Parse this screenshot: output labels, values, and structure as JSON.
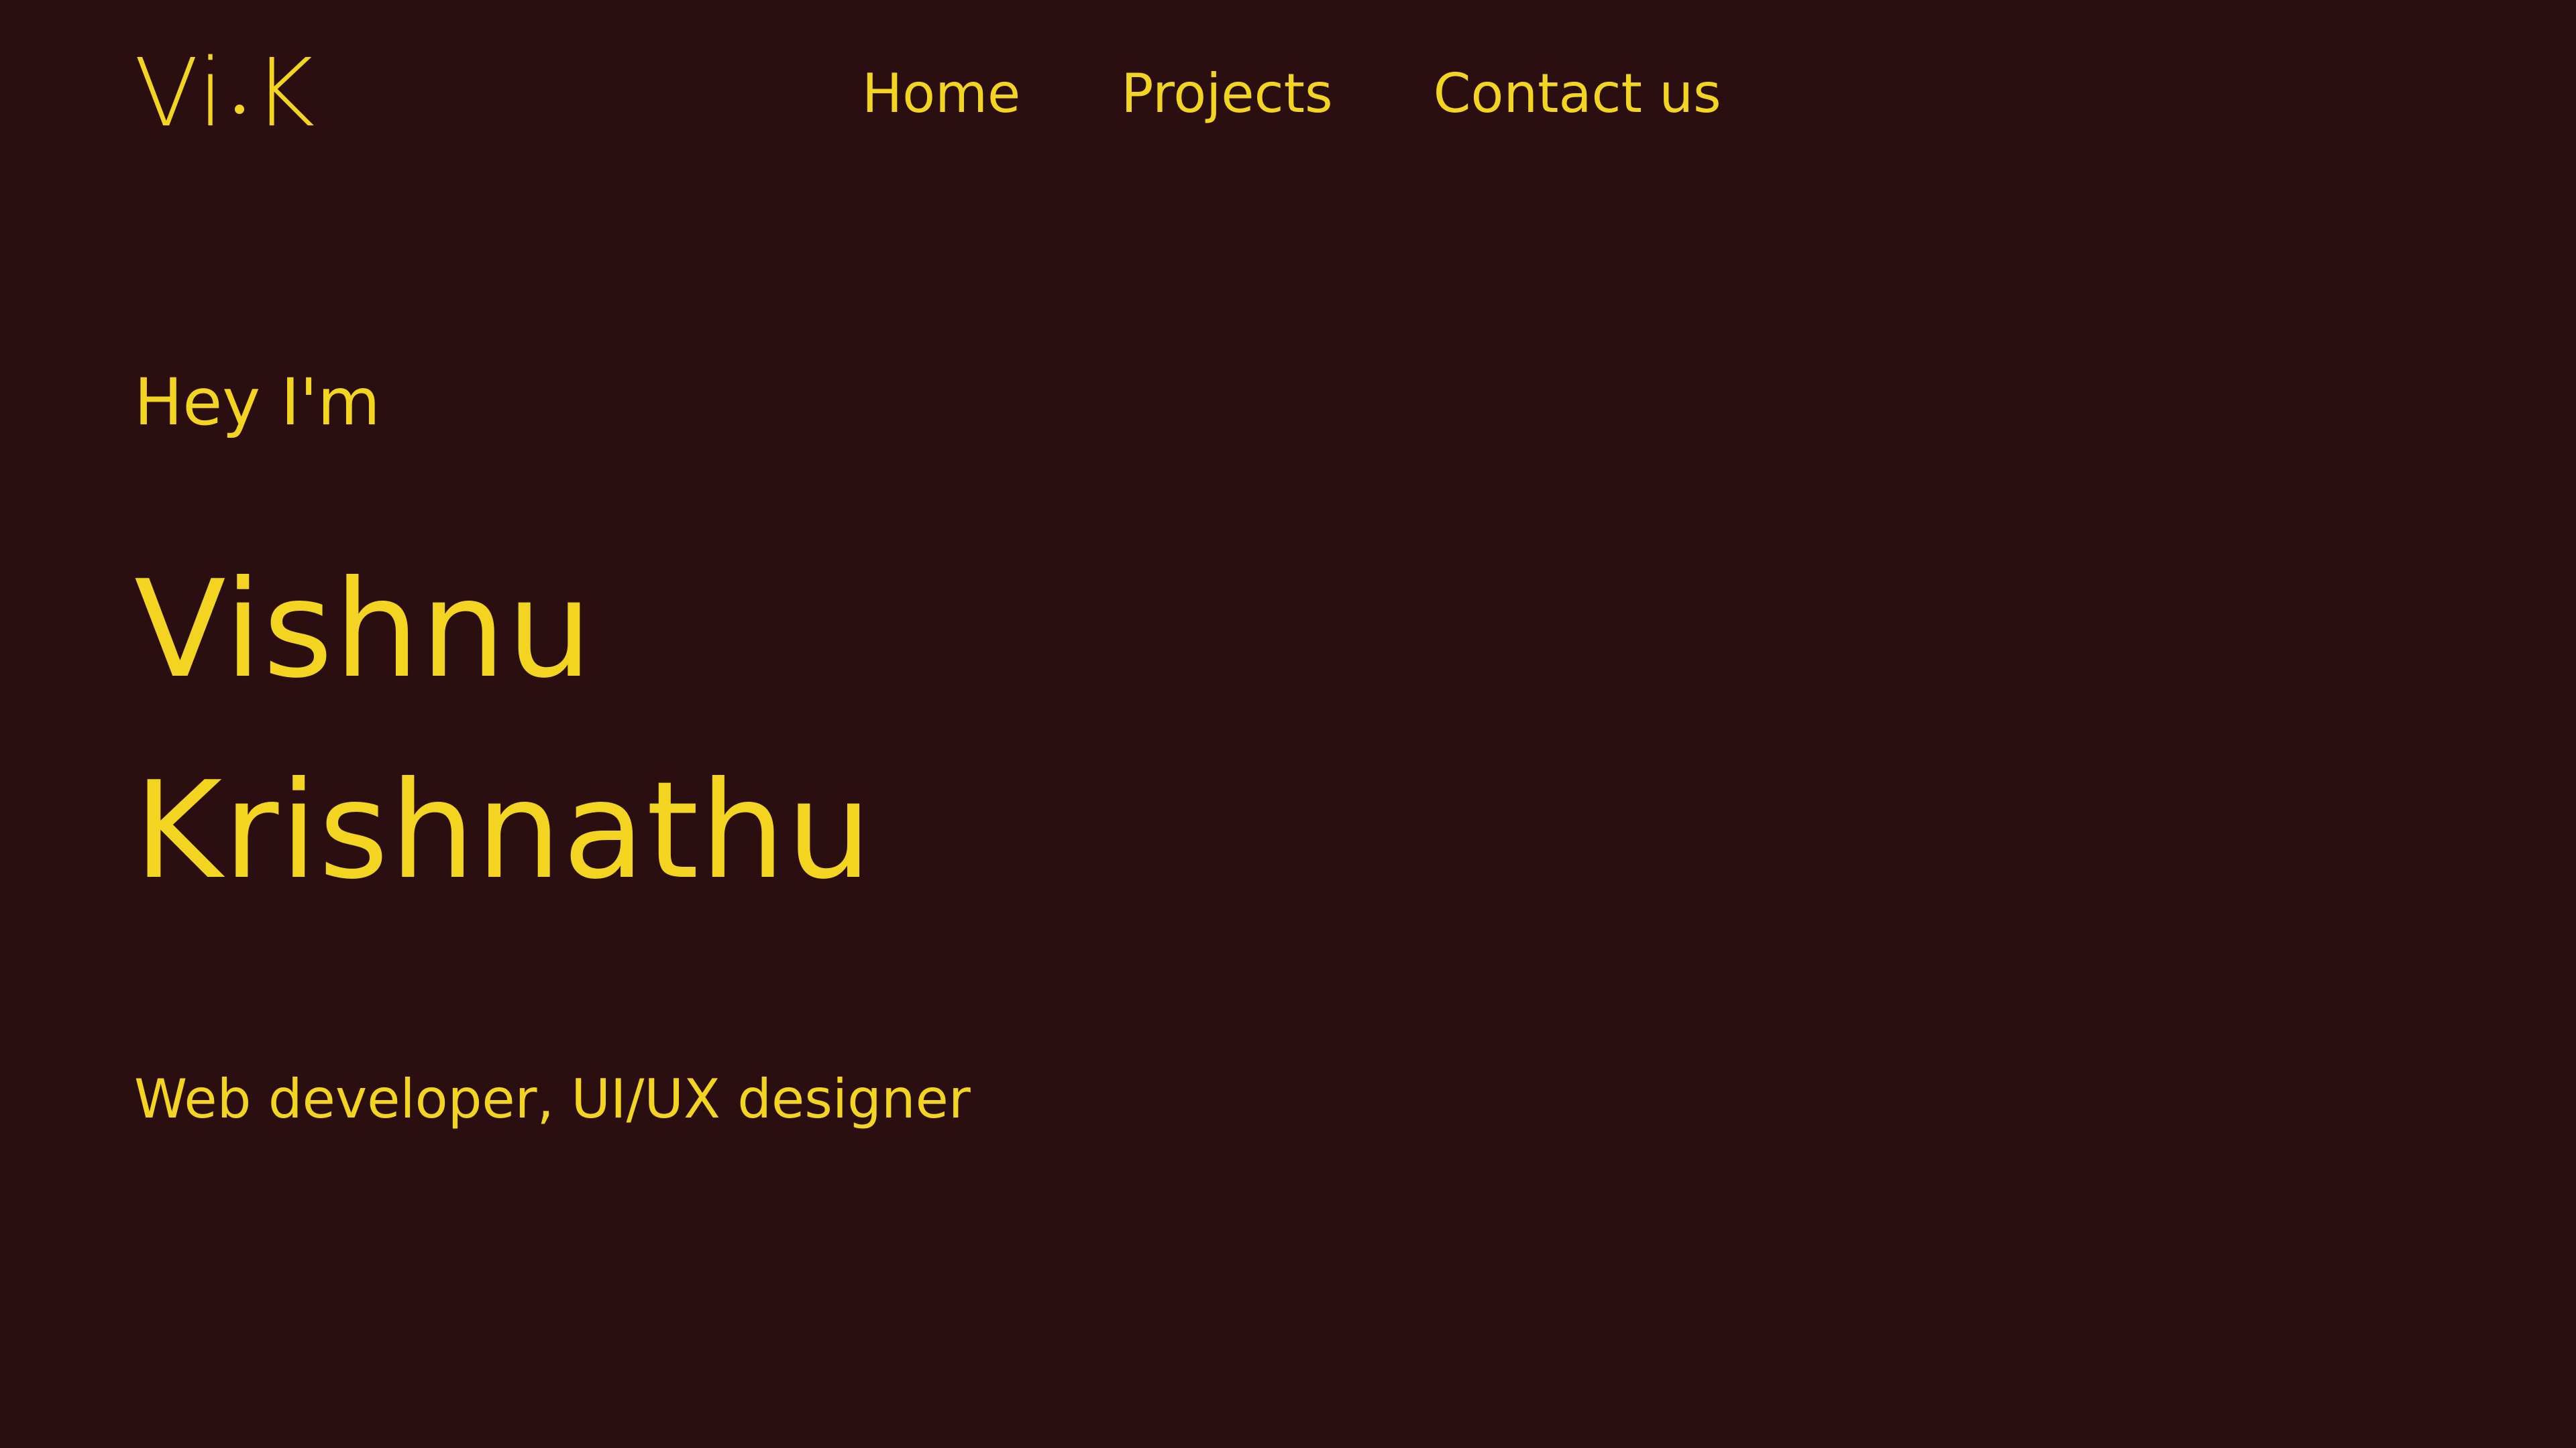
{
  "header": {
    "logo_left": "Vi",
    "logo_right": "K",
    "nav": [
      {
        "label": "Home"
      },
      {
        "label": "Projects"
      },
      {
        "label": "Contact us"
      }
    ]
  },
  "hero": {
    "greeting": "Hey I'm",
    "first_name": "Vishnu",
    "last_name": "Krishnathu",
    "role": "Web developer, UI/UX designer"
  },
  "colors": {
    "background": "#2a0e10",
    "accent": "#f3d521"
  }
}
